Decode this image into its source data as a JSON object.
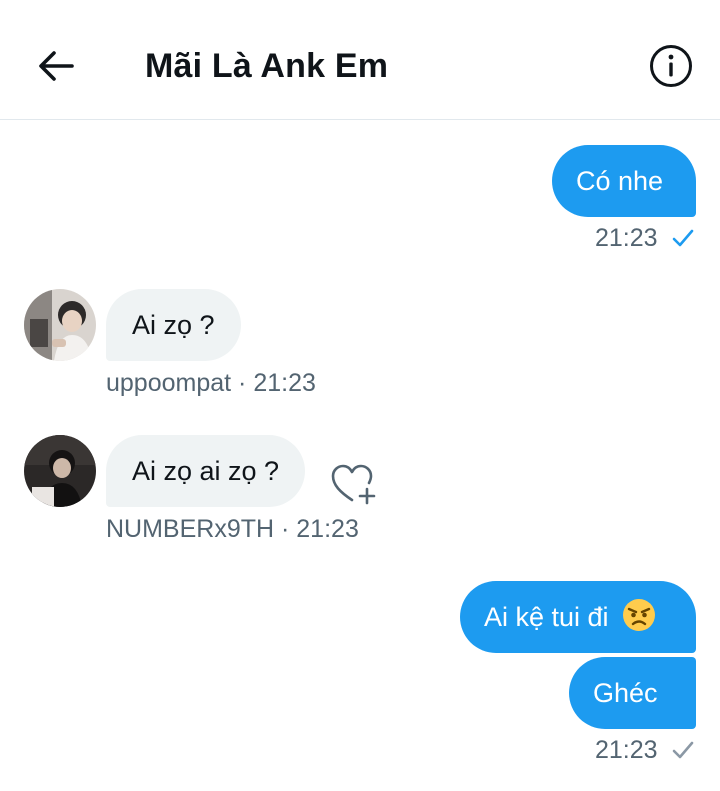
{
  "header": {
    "title": "Mãi Là Ank Em",
    "back_icon": "arrow-left-icon",
    "info_icon": "info-circle-icon"
  },
  "messages": [
    {
      "direction": "out",
      "text": "Có nhe",
      "time": "21:23",
      "status": "seen-check-icon"
    },
    {
      "direction": "in",
      "text": "Ai zọ ?",
      "sender": "uppoompat",
      "time": "21:23",
      "sender_meta": "uppoompat · 21:23"
    },
    {
      "direction": "in",
      "text": "Ai zọ ai zọ ?",
      "sender": "NUMBERx9TH",
      "time": "21:23",
      "sender_meta": "NUMBERx9TH · 21:23",
      "reaction_icon": "heart-add-icon"
    },
    {
      "direction": "out",
      "text": "Ai kệ tui đi",
      "emoji": "angry-face-emoji"
    },
    {
      "direction": "out",
      "text": "Ghéc",
      "time": "21:23",
      "status": "sent-check-icon"
    }
  ],
  "colors": {
    "accent": "#1d9bf0",
    "incoming_bubble": "#eff3f4",
    "meta_text": "#536471",
    "check_sent": "#8b98a5"
  }
}
